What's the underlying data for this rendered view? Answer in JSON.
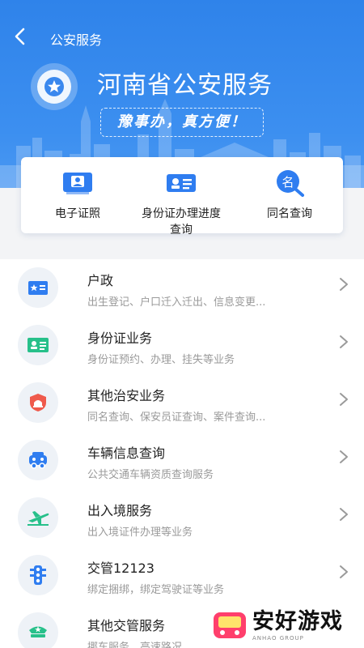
{
  "header": {
    "back_icon": "chevron-left-icon",
    "title": "公安服务"
  },
  "hero": {
    "title": "河南省公安服务",
    "slogan": "豫事办，真方便！",
    "emblem_icon": "police-badge-icon"
  },
  "quick_actions": [
    {
      "label": "电子证照",
      "icon": "id-card-photo-icon"
    },
    {
      "label": "身份证办理进度查询",
      "label_lines": [
        "身份证办理进度",
        "查询"
      ],
      "icon": "id-card-icon"
    },
    {
      "label": "同名查询",
      "icon": "name-search-icon"
    }
  ],
  "services": [
    {
      "title": "户政",
      "subtitle": "出生登记、户口迁入迁出、信息变更...",
      "icon": "household-register-icon"
    },
    {
      "title": "身份证业务",
      "subtitle": "身份证预约、办理、挂失等业务",
      "icon": "id-card-icon"
    },
    {
      "title": "其他治安业务",
      "subtitle": "同名查询、保安员证查询、案件查询...",
      "icon": "police-light-icon"
    },
    {
      "title": "车辆信息查询",
      "subtitle": "公共交通车辆资质查询服务",
      "icon": "vehicle-icon"
    },
    {
      "title": "出入境服务",
      "subtitle": "出入境证件办理等业务",
      "icon": "airplane-icon"
    },
    {
      "title": "交管12123",
      "subtitle": "绑定捆绑，绑定驾驶证等业务",
      "icon": "traffic-light-icon"
    },
    {
      "title": "其他交管服务",
      "subtitle": "挪车服务、高速路况",
      "icon": "traffic-police-icon"
    }
  ],
  "watermark": {
    "text": "安好游戏",
    "sub": "ANHAO GROUP"
  },
  "colors": {
    "primary": "#2f83ea",
    "icon_blue": "#2f7df0",
    "icon_green": "#27c08a",
    "icon_red": "#ef5a4c"
  }
}
